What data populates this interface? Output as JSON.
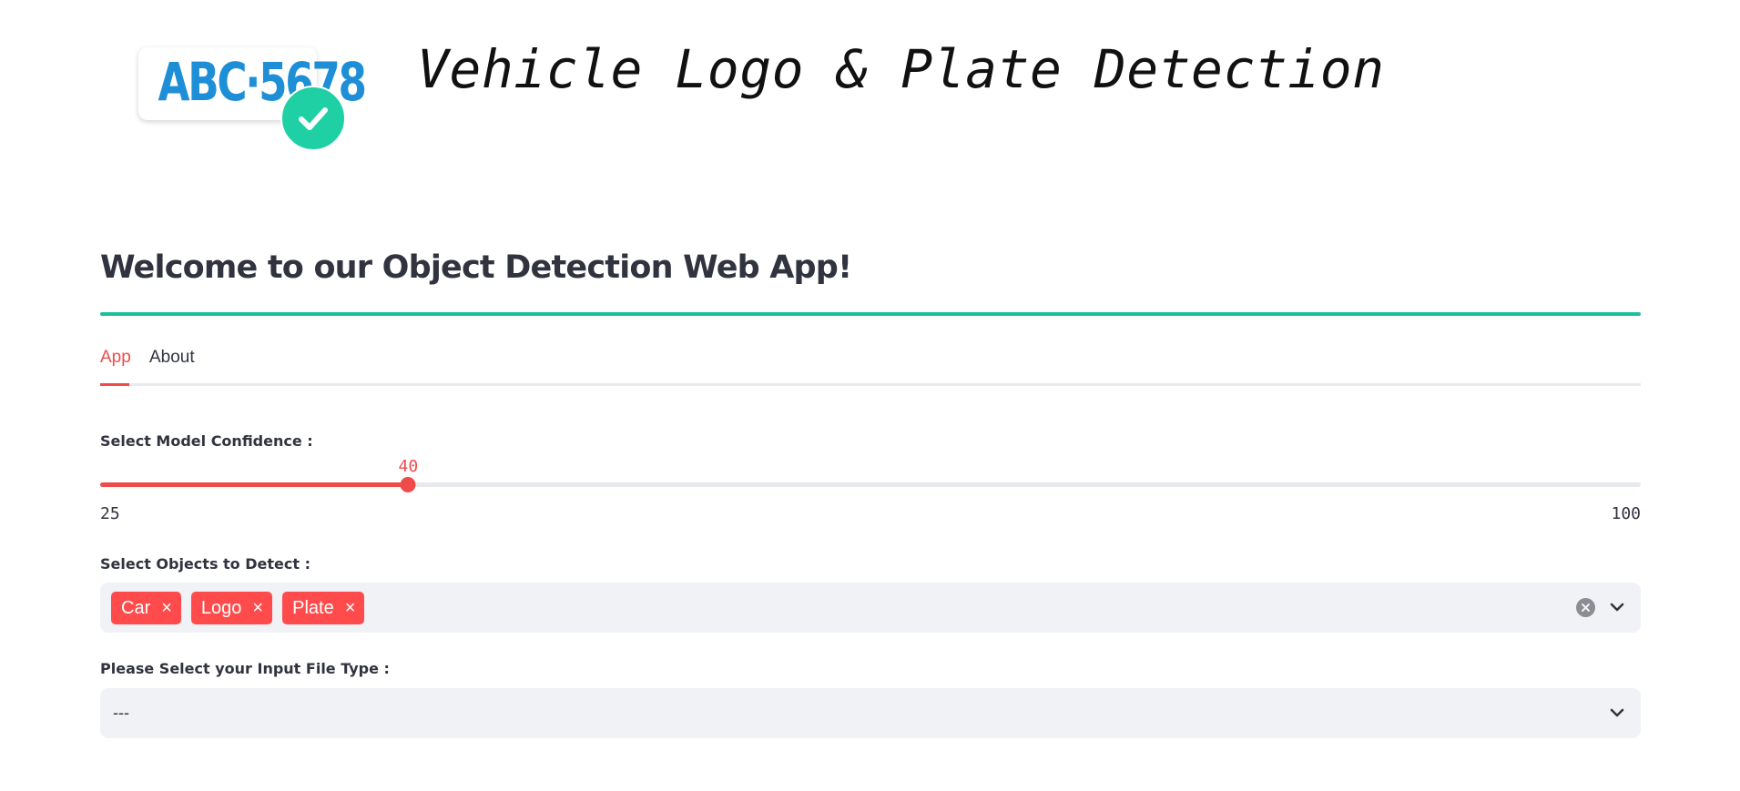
{
  "logo": {
    "plate_text": "ABC·5678",
    "plate_color": "#1e8fd6",
    "badge_color": "#1fd0a5",
    "badge_icon": "checkmark-icon"
  },
  "header": {
    "title": "Vehicle Logo & Plate Detection"
  },
  "main": {
    "welcome": "Welcome to our Object Detection Web App!",
    "divider_color": "#1dbf9b",
    "accent_color": "#f04b4b"
  },
  "tabs": [
    {
      "label": "App",
      "active": true
    },
    {
      "label": "About",
      "active": false
    }
  ],
  "confidence": {
    "label": "Select Model Confidence :",
    "min": 25,
    "max": 100,
    "value": 40,
    "min_label": "25",
    "max_label": "100",
    "value_label": "40"
  },
  "objects": {
    "label": "Select Objects to Detect :",
    "chips": [
      "Car",
      "Logo",
      "Plate"
    ],
    "chip_remove_glyph": "×",
    "clear_icon": "clear-all-icon",
    "dropdown_icon": "chevron-down-icon"
  },
  "file_type": {
    "label": "Please Select your Input File Type :",
    "value": "---",
    "dropdown_icon": "chevron-down-icon"
  }
}
